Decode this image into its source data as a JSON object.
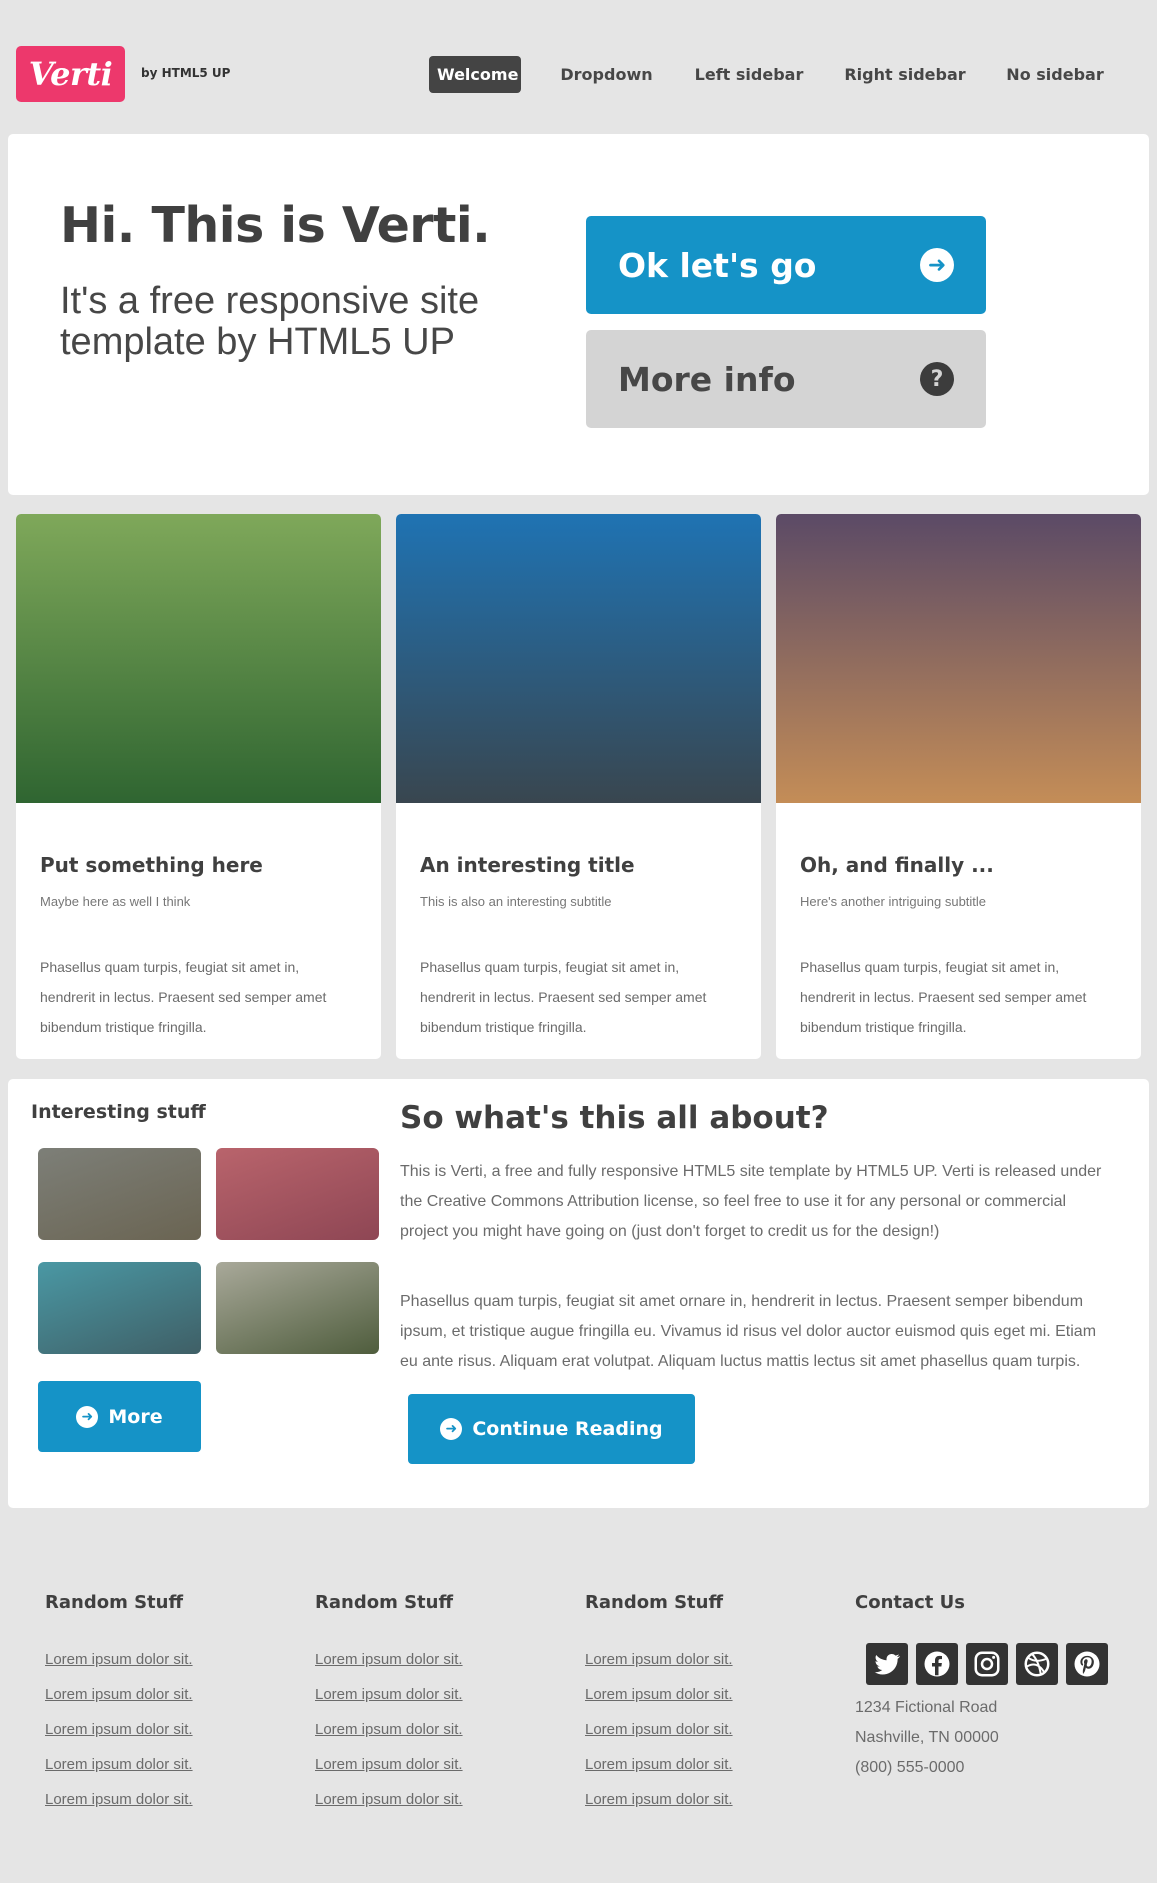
{
  "header": {
    "logo": "Verti",
    "byline": "by HTML5 UP",
    "nav": [
      {
        "label": "Welcome",
        "active": true
      },
      {
        "label": "Dropdown",
        "active": false
      },
      {
        "label": "Left sidebar",
        "active": false
      },
      {
        "label": "Right sidebar",
        "active": false
      },
      {
        "label": "No sidebar",
        "active": false
      }
    ]
  },
  "banner": {
    "title": "Hi. This is Verti.",
    "subtitle": "It's a free responsive site template by HTML5 UP",
    "primary_button": "Ok let's go",
    "secondary_button": "More info"
  },
  "features": [
    {
      "title": "Put something here",
      "subtitle": "Maybe here as well I think",
      "body": "Phasellus quam turpis, feugiat sit amet in, hendrerit in lectus. Praesent sed semper amet bibendum tristique fringilla.",
      "gradient_top": "#7fa85a",
      "gradient_bottom": "#2f6531"
    },
    {
      "title": "An interesting title",
      "subtitle": "This is also an interesting subtitle",
      "body": "Phasellus quam turpis, feugiat sit amet in, hendrerit in lectus. Praesent sed semper amet bibendum tristique fringilla.",
      "gradient_top": "#1f73b3",
      "gradient_bottom": "#39464f"
    },
    {
      "title": "Oh, and finally ...",
      "subtitle": "Here's another intriguing subtitle",
      "body": "Phasellus quam turpis, feugiat sit amet in, hendrerit in lectus. Praesent sed semper amet bibendum tristique fringilla.",
      "gradient_top": "#5b4a66",
      "gradient_bottom": "#c48d57"
    }
  ],
  "sidebar": {
    "title": "Interesting stuff",
    "thumbs": [
      {
        "from": "#7d7f78",
        "to": "#6a6452"
      },
      {
        "from": "#b9646c",
        "to": "#8e4654"
      },
      {
        "from": "#4a98a4",
        "to": "#3f5f66"
      },
      {
        "from": "#a9a99a",
        "to": "#4f5d3d"
      }
    ],
    "more_button": "More"
  },
  "main": {
    "title": "So what's this all about?",
    "paragraph1": "This is Verti, a free and fully responsive HTML5 site template by HTML5 UP. Verti is released under the Creative Commons Attribution license, so feel free to use it for any personal or commercial project you might have going on (just don't forget to credit us for the design!)",
    "paragraph2": "Phasellus quam turpis, feugiat sit amet ornare in, hendrerit in lectus. Praesent semper bibendum ipsum, et tristique augue fringilla eu. Vivamus id risus vel dolor auctor euismod quis eget mi. Etiam eu ante risus. Aliquam erat volutpat. Aliquam luctus mattis lectus sit amet phasellus quam turpis.",
    "continue_button": "Continue Reading"
  },
  "footer": {
    "columns": [
      {
        "title": "Random Stuff",
        "links": [
          "Lorem ipsum dolor sit.",
          "Lorem ipsum dolor sit.",
          "Lorem ipsum dolor sit.",
          "Lorem ipsum dolor sit.",
          "Lorem ipsum dolor sit."
        ]
      },
      {
        "title": "Random Stuff",
        "links": [
          "Lorem ipsum dolor sit.",
          "Lorem ipsum dolor sit.",
          "Lorem ipsum dolor sit.",
          "Lorem ipsum dolor sit.",
          "Lorem ipsum dolor sit."
        ]
      },
      {
        "title": "Random Stuff",
        "links": [
          "Lorem ipsum dolor sit.",
          "Lorem ipsum dolor sit.",
          "Lorem ipsum dolor sit.",
          "Lorem ipsum dolor sit.",
          "Lorem ipsum dolor sit."
        ]
      }
    ],
    "contact": {
      "title": "Contact Us",
      "social": [
        "twitter-icon",
        "facebook-icon",
        "instagram-icon",
        "dribbble-icon",
        "pinterest-icon"
      ],
      "address1": "1234 Fictional Road",
      "address2": "Nashville, TN 00000",
      "phone": "(800) 555-0000"
    }
  },
  "colors": {
    "brand_pink": "#ed386c",
    "accent_blue": "#1593c7",
    "background": "#e5e5e5"
  }
}
